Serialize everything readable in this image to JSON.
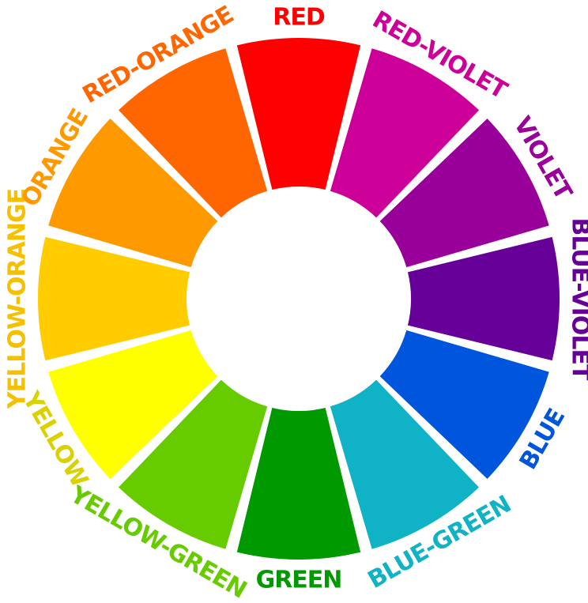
{
  "wheel": {
    "segments": [
      {
        "label": "RED",
        "color": "#FF0000"
      },
      {
        "label": "RED-VIOLET",
        "color": "#CC0099"
      },
      {
        "label": "VIOLET",
        "color": "#990099"
      },
      {
        "label": "BLUE-VIOLET",
        "color": "#660099"
      },
      {
        "label": "BLUE",
        "color": "#0055DD"
      },
      {
        "label": "BLUE-GREEN",
        "color": "#10B3C6"
      },
      {
        "label": "GREEN",
        "color": "#009900"
      },
      {
        "label": "YELLOW-GREEN",
        "color": "#66CC00"
      },
      {
        "label": "YELLOW",
        "color": "#FFFF00"
      },
      {
        "label": "YELLOW-ORANGE",
        "color": "#FFCC00"
      },
      {
        "label": "ORANGE",
        "color": "#FF9900"
      },
      {
        "label": "RED-ORANGE",
        "color": "#FF6600"
      }
    ],
    "label_colors": {
      "YELLOW": "#D9D100",
      "YELLOW-ORANGE": "#F5C000"
    }
  }
}
